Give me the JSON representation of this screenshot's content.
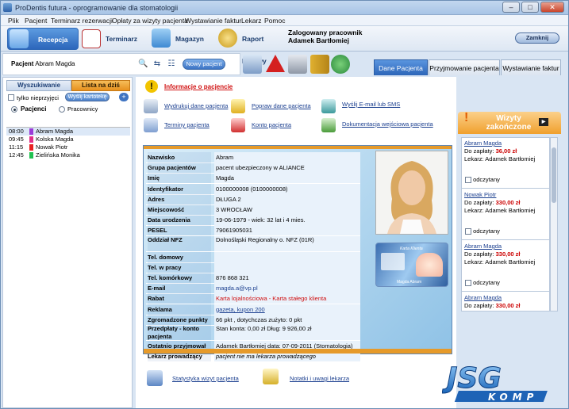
{
  "window": {
    "title": "ProDentis futura - oprogramowanie dla stomatologii",
    "btn_min": "–",
    "btn_max": "□",
    "btn_close": "✕"
  },
  "menu": [
    "Plik",
    "Pacjent",
    "Terminarz rezerwacji",
    "Opłaty za wizyty pacjenta",
    "Wystawianie faktur",
    "Lekarz",
    "Pomoc"
  ],
  "toolbar": {
    "recepcja": "Recepcja",
    "terminarz": "Terminarz",
    "magazyn": "Magazyn",
    "raport": "Raport kasowy",
    "logged_label": "Zalogowany pracownik",
    "logged_user": "Adamek Bartłomiej",
    "zamknij": "Zamknij"
  },
  "patient_bar": {
    "label": "Pacjent",
    "name": "Abram Magda",
    "nowy": "Nowy pacjent"
  },
  "right_tabs": [
    "Dane Pacjenta",
    "Przyjmowanie pacjenta",
    "Wystawianie faktur"
  ],
  "left": {
    "tab_search": "Wyszukiwanie",
    "tab_list": "Lista na dziś",
    "only_unadmitted": "tylko nieprzyjęci",
    "send_card": "Wyślij kartotekę",
    "plus": "+",
    "radio_patients": "Pacjenci",
    "radio_staff": "Pracownicy",
    "appointments": [
      {
        "time": "08:00",
        "color": "#9a3bd8",
        "name": "Abram Magda"
      },
      {
        "time": "09:45",
        "color": "#e0308a",
        "name": "Kolska Magda"
      },
      {
        "time": "11:15",
        "color": "#e82020",
        "name": "Nowak Piotr"
      },
      {
        "time": "12:45",
        "color": "#20c050",
        "name": "Zielińska Monika"
      }
    ]
  },
  "info": {
    "title": "Informacje o pacjencie",
    "actions": [
      "Wydrukuj dane pacjenta",
      "Popraw dane pacjenta",
      "Wyślij E-mail lub SMS",
      "Terminy pacjenta",
      "Konto pacjenta",
      "Dokumentacja wejściowa pacjenta"
    ]
  },
  "patient": {
    "rows": [
      {
        "k": "Nazwisko",
        "v": "Abram"
      },
      {
        "k": "Grupa pacjentów",
        "v": "pacent ubezpieczony w ALIANCE"
      },
      {
        "k": "Imię",
        "v": "Magda"
      },
      {
        "k": "Identyfikator",
        "v": "0100000008 (0100000008)"
      },
      {
        "k": "Adres",
        "v": "DŁUGA 2"
      },
      {
        "k": "Miejscowość",
        "v": "3 WROCŁAW"
      },
      {
        "k": "Data urodzenia",
        "v": "19-06-1979 - wiek: 32 lat i 4 mies."
      },
      {
        "k": "PESEL",
        "v": "79061905031"
      },
      {
        "k": "Oddział NFZ",
        "v": "Dolnośląski Regionalny o. NFZ (01R)"
      },
      {
        "k": "Tel. domowy",
        "v": ""
      },
      {
        "k": "Tel. w pracy",
        "v": ""
      },
      {
        "k": "Tel. komórkowy",
        "v": "876 868 321"
      },
      {
        "k": "E-mail",
        "v": "magda.a@vp.pl"
      },
      {
        "k": "Rabat",
        "v": "Karta lojalnościowa - Karta stałego klienta"
      },
      {
        "k": "Reklama",
        "v": "gazeta, kupon 200"
      },
      {
        "k": "Zgromadzone punkty",
        "v": "66 pkt , dotychczas zużyto: 0 pkt"
      },
      {
        "k": "Przedpłaty - konto pacjenta",
        "v": "Stan konta:  0,00  zł   Dług:  9 926,00 zł"
      },
      {
        "k": "Ostatnio przyjmował",
        "v": "Adamek Bartłomiej data: 07-09-2011  (Stomatologia)"
      },
      {
        "k": "Lekarz prowadzący",
        "v": "pacjent nie ma lekarza prowadzącego"
      }
    ],
    "card_title": "Karta Klienta",
    "card_name": "Magda Abram"
  },
  "bottom_links": [
    "Statystyka wizyt pacjenta",
    "Notatki i uwagi lekarza"
  ],
  "visits": {
    "title": "Wizyty zakończone",
    "items": [
      {
        "name": "Abram Magda",
        "pay_label": "Do zapłaty:",
        "amount": "36,00 zł",
        "doctor": "Lekarz:  Adamek Bartłomiej",
        "read": "odczytany"
      },
      {
        "name": "Nowak Piotr",
        "pay_label": "Do zapłaty:",
        "amount": "330,00 zł",
        "doctor": "Lekarz:  Adamek Bartłomiej",
        "read": "odczytany"
      },
      {
        "name": "Abram Magda",
        "pay_label": "Do zapłaty:",
        "amount": "330,00 zł",
        "doctor": "Lekarz:  Adamek Bartłomiej",
        "read": "odczytany"
      },
      {
        "name": "Abram Magda",
        "pay_label": "Do zapłaty:",
        "amount": "330,00 zł",
        "doctor": "",
        "read": ""
      }
    ]
  },
  "logo": {
    "top": "JSC",
    "bottom": "KOMP"
  }
}
